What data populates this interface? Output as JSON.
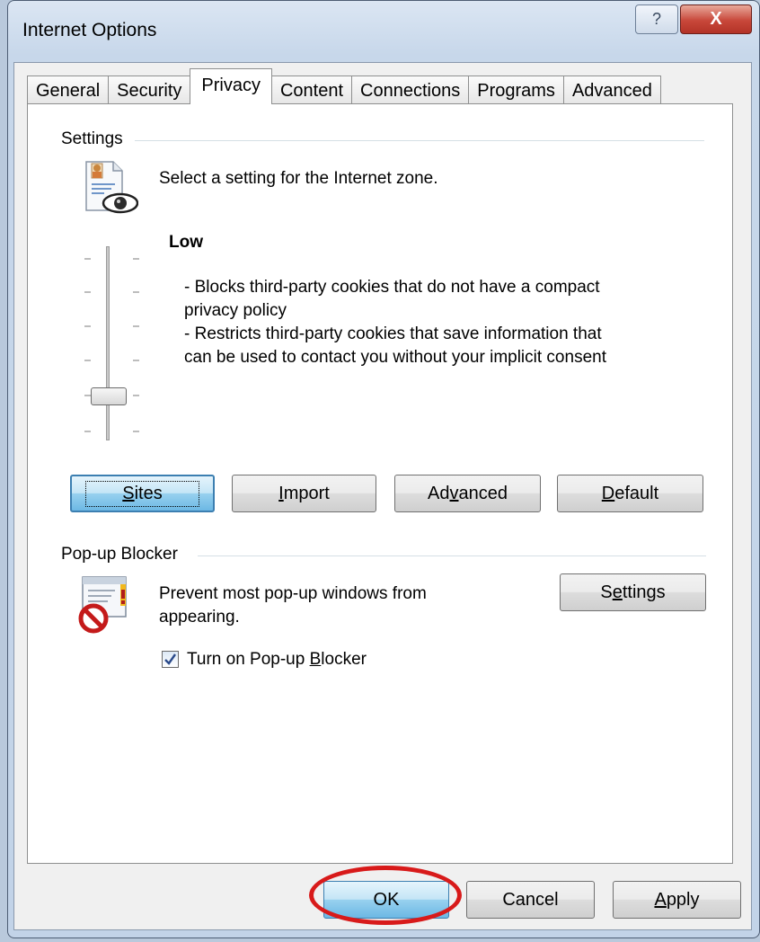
{
  "window": {
    "title": "Internet Options",
    "help_glyph": "?",
    "close_glyph": "X"
  },
  "tabs": [
    {
      "label": "General"
    },
    {
      "label": "Security"
    },
    {
      "label": "Privacy"
    },
    {
      "label": "Content"
    },
    {
      "label": "Connections"
    },
    {
      "label": "Programs"
    },
    {
      "label": "Advanced"
    }
  ],
  "active_tab": "Privacy",
  "settings": {
    "group_label": "Settings",
    "instruction": "Select a setting for the Internet zone.",
    "level_name": "Low",
    "description_line1": "- Blocks third-party cookies that do not have a compact",
    "description_line2": "privacy policy",
    "description_line3": "- Restricts third-party cookies that save information that",
    "description_line4": "can be used to contact you without your implicit consent",
    "slider_level": "Low",
    "slider_position_fraction": 0.2,
    "icon": "privacy-eye-icon"
  },
  "settings_buttons": {
    "sites": {
      "pre": "",
      "u": "S",
      "post": "ites"
    },
    "import": {
      "pre": "",
      "u": "I",
      "post": "mport"
    },
    "advanced": {
      "pre": "Ad",
      "u": "v",
      "post": "anced"
    },
    "default": {
      "pre": "",
      "u": "D",
      "post": "efault"
    }
  },
  "popup": {
    "group_label": "Pop-up Blocker",
    "description_line1": "Prevent most pop-up windows from",
    "description_line2": "appearing.",
    "settings_button": {
      "pre": "S",
      "u": "e",
      "post": "ttings"
    },
    "checkbox_label": {
      "pre": "Turn on Pop-up ",
      "u": "B",
      "post": "locker"
    },
    "checkbox_checked": true,
    "icon": "popup-blocked-icon"
  },
  "footer": {
    "ok": "OK",
    "cancel": "Cancel",
    "apply": {
      "pre": "",
      "u": "A",
      "post": "pply"
    }
  },
  "colors": {
    "highlight_oval": "#d81a1a",
    "focus_button": "#98d1ef"
  }
}
